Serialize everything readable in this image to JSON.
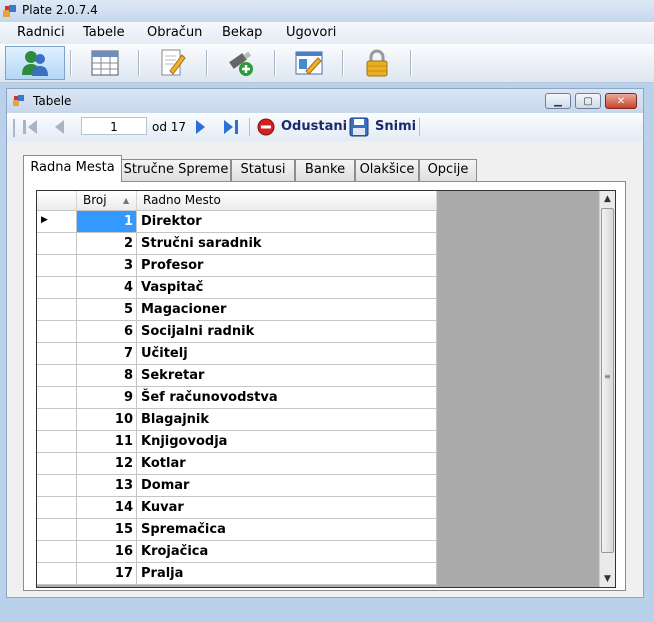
{
  "window": {
    "title": "Plate 2.0.7.4"
  },
  "menu": [
    "Radnici",
    "Tabele",
    "Obračun",
    "Bekap",
    "Ugovori"
  ],
  "toolbar_icons": [
    "users-icon",
    "table-icon",
    "document-edit-icon",
    "usb-add-icon",
    "chart-edit-icon",
    "lock-icon"
  ],
  "child_window": {
    "title": "Tabele"
  },
  "navigator": {
    "position": "1",
    "of_label": "od 17",
    "cancel_label": "Odustani",
    "save_label": "Snimi"
  },
  "tabs": [
    "Radna Mesta",
    "Stručne Spreme",
    "Statusi",
    "Banke",
    "Olakšice",
    "Opcije"
  ],
  "grid": {
    "headers": {
      "broj": "Broj",
      "name": "Radno Mesto"
    },
    "rows": [
      {
        "broj": "1",
        "name": "Direktor"
      },
      {
        "broj": "2",
        "name": "Stručni saradnik"
      },
      {
        "broj": "3",
        "name": "Profesor"
      },
      {
        "broj": "4",
        "name": "Vaspitač"
      },
      {
        "broj": "5",
        "name": "Magacioner"
      },
      {
        "broj": "6",
        "name": "Socijalni radnik"
      },
      {
        "broj": "7",
        "name": "Učitelj"
      },
      {
        "broj": "8",
        "name": "Sekretar"
      },
      {
        "broj": "9",
        "name": "Šef računovodstva"
      },
      {
        "broj": "10",
        "name": "Blagajnik"
      },
      {
        "broj": "11",
        "name": "Knjigovodja"
      },
      {
        "broj": "12",
        "name": "Kotlar"
      },
      {
        "broj": "13",
        "name": "Domar"
      },
      {
        "broj": "14",
        "name": "Kuvar"
      },
      {
        "broj": "15",
        "name": "Spremačica"
      },
      {
        "broj": "16",
        "name": "Krojačica"
      },
      {
        "broj": "17",
        "name": "Pralja"
      }
    ]
  }
}
